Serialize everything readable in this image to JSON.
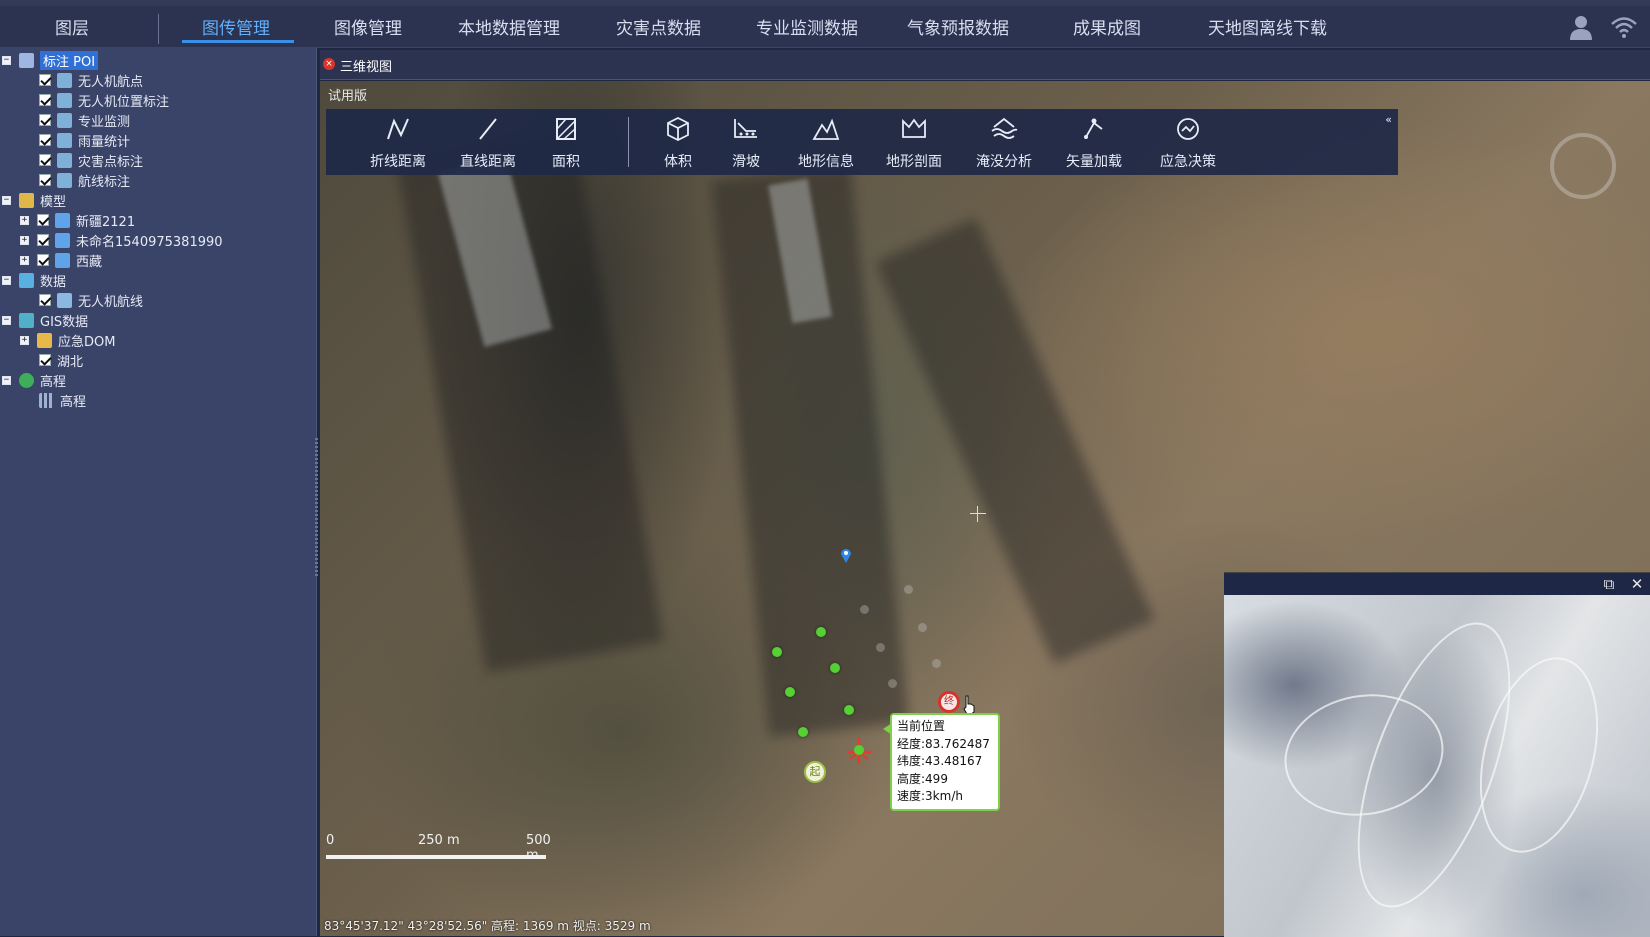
{
  "topnav": {
    "items": [
      "图层",
      "图传管理",
      "图像管理",
      "本地数据管理",
      "灾害点数据",
      "专业监测数据",
      "气象预报数据",
      "成果成图",
      "天地图离线下载"
    ],
    "active_index": 1
  },
  "sidebar": {
    "groups": [
      {
        "label": "标注 POI",
        "children": [
          "无人机航点",
          "无人机位置标注",
          "专业监测",
          "雨量统计",
          "灾害点标注",
          "航线标注"
        ]
      },
      {
        "label": "模型",
        "children": [
          "新疆2121",
          "未命名1540975381990",
          "西藏"
        ]
      },
      {
        "label": "数据",
        "children": [
          "无人机航线"
        ]
      },
      {
        "label": "GIS数据",
        "children": [
          "应急DOM",
          "湖北"
        ]
      },
      {
        "label": "高程",
        "children": [
          "高程"
        ]
      }
    ]
  },
  "view": {
    "tab_title": "三维视图",
    "close_symbol": "×",
    "trial_label": "试用版",
    "collapse_symbol": "«"
  },
  "toolbar": {
    "tools": [
      {
        "label": "折线距离",
        "icon": "polyline-icon"
      },
      {
        "label": "直线距离",
        "icon": "line-icon"
      },
      {
        "label": "面积",
        "icon": "area-icon"
      },
      {
        "label": "体积",
        "icon": "cube-icon"
      },
      {
        "label": "滑坡",
        "icon": "landslide-icon"
      },
      {
        "label": "地形信息",
        "icon": "mountain-icon"
      },
      {
        "label": "地形剖面",
        "icon": "profile-icon"
      },
      {
        "label": "淹没分析",
        "icon": "flood-icon"
      },
      {
        "label": "矢量加载",
        "icon": "vector-icon"
      },
      {
        "label": "应急决策",
        "icon": "decision-icon"
      }
    ]
  },
  "drone_info": {
    "title": "当前位置",
    "longitude": "经度:83.762487",
    "latitude": "纬度:43.48167",
    "altitude": "高度:499",
    "speed": "速度:3km/h"
  },
  "scale": {
    "zero": "0",
    "mid": "250 m",
    "max": "500 m"
  },
  "status": "83°45'37.12\" 43°28'52.56\"  高程: 1369 m 视点: 3529 m",
  "markers": {
    "start_label": "起",
    "end_label": "终"
  },
  "miniview": {
    "restore_symbol": "⧉",
    "close_symbol": "✕"
  },
  "colors": {
    "accent": "#3b8fe6",
    "route_dot": "#56d134",
    "marker_red": "#d8332b"
  }
}
